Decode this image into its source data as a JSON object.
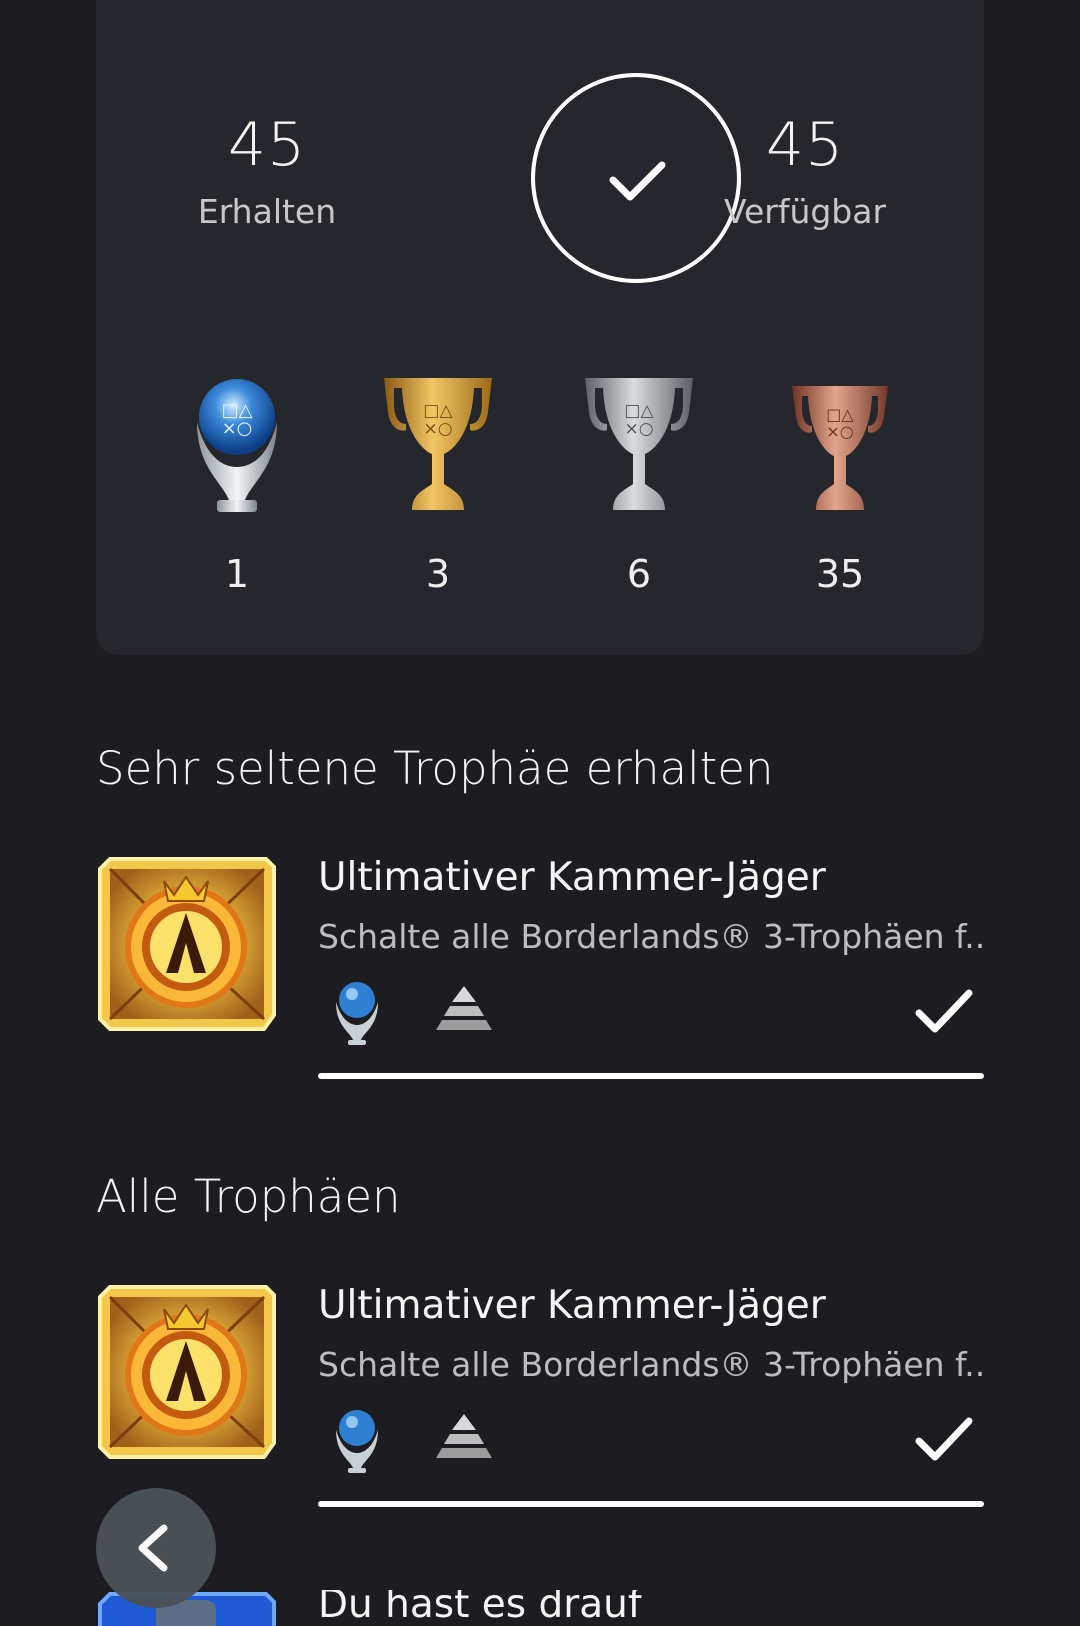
{
  "summary": {
    "earned_value": "45",
    "earned_label": "Erhalten",
    "available_value": "45",
    "available_label": "Verfügbar",
    "completion_icon": "check-icon",
    "trophies": [
      {
        "type": "platinum",
        "icon": "platinum-trophy-icon",
        "count": "1"
      },
      {
        "type": "gold",
        "icon": "gold-trophy-icon",
        "count": "3"
      },
      {
        "type": "silver",
        "icon": "silver-trophy-icon",
        "count": "6"
      },
      {
        "type": "bronze",
        "icon": "bronze-trophy-icon",
        "count": "35"
      }
    ]
  },
  "rare_section": {
    "title": "Sehr seltene Trophäe erhalten",
    "item": {
      "name": "Ultimativer Kammer-Jäger",
      "description": "Schalte alle Borderlands® 3-Trophäen f...",
      "grade_icon": "platinum-trophy-icon",
      "rarity_icon": "rarity-pyramid-icon",
      "earned_icon": "check-icon"
    }
  },
  "all_section": {
    "title": "Alle Trophäen",
    "items": [
      {
        "name": "Ultimativer Kammer-Jäger",
        "description": "Schalte alle Borderlands® 3-Trophäen f...",
        "grade_icon": "platinum-trophy-icon",
        "rarity_icon": "rarity-pyramid-icon",
        "earned_icon": "check-icon"
      },
      {
        "name": "Du hast es drauf"
      }
    ]
  },
  "navigation": {
    "back_icon": "chevron-left-icon"
  },
  "colors": {
    "background": "#1d1d21",
    "card": "#25272c",
    "text": "#f5f5f5",
    "muted_text": "#bdbdbd"
  }
}
